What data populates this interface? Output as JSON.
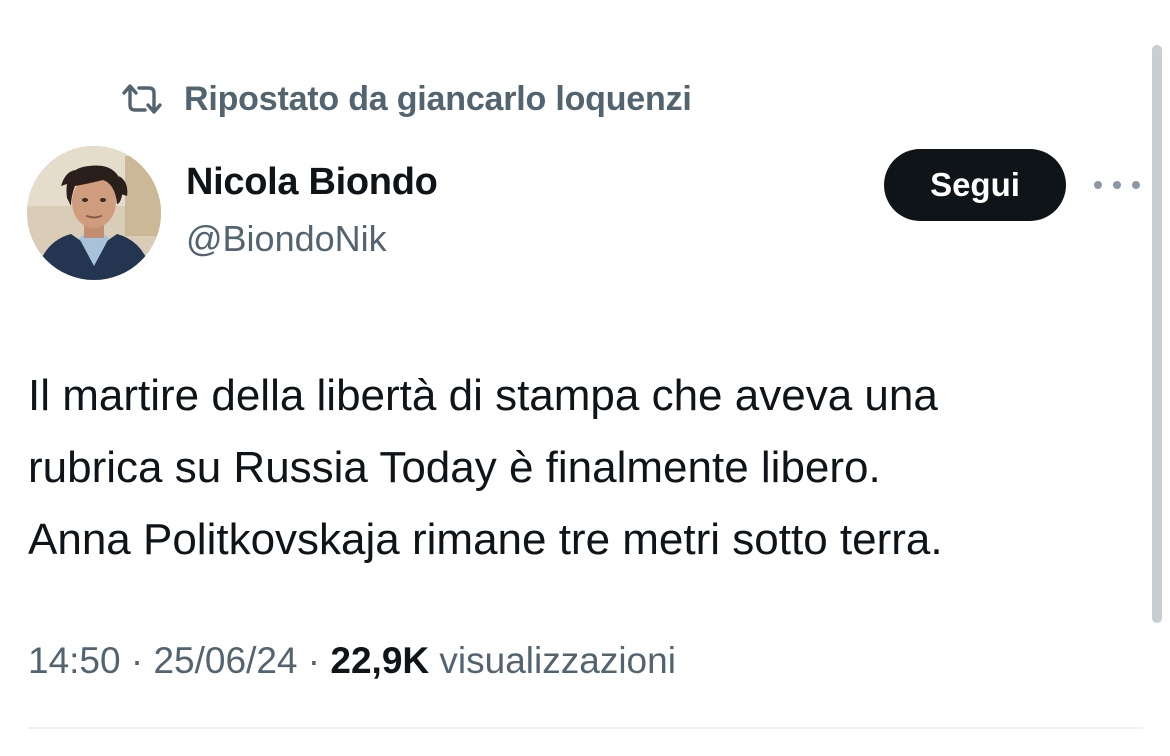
{
  "repost": {
    "icon": "repost-icon",
    "text": "Ripostato da giancarlo loquenzi"
  },
  "author": {
    "display_name": "Nicola Biondo",
    "handle": "@BiondoNik",
    "avatar": "avatar-photo"
  },
  "actions": {
    "follow_label": "Segui",
    "more_icon": "more-icon"
  },
  "tweet": {
    "lines": [
      "Il martire della libertà di stampa che aveva una",
      "rubrica su Russia Today è finalmente libero.",
      "Anna Politkovskaja rimane tre metri sotto terra."
    ]
  },
  "meta": {
    "time": "14:50",
    "separator": " · ",
    "date": "25/06/24",
    "views_count": "22,9K",
    "views_label": "visualizzazioni"
  },
  "colors": {
    "text_primary": "#0f1419",
    "text_secondary": "#536471",
    "button_bg": "#0f1419",
    "button_text": "#ffffff",
    "divider": "#eff3f4"
  }
}
